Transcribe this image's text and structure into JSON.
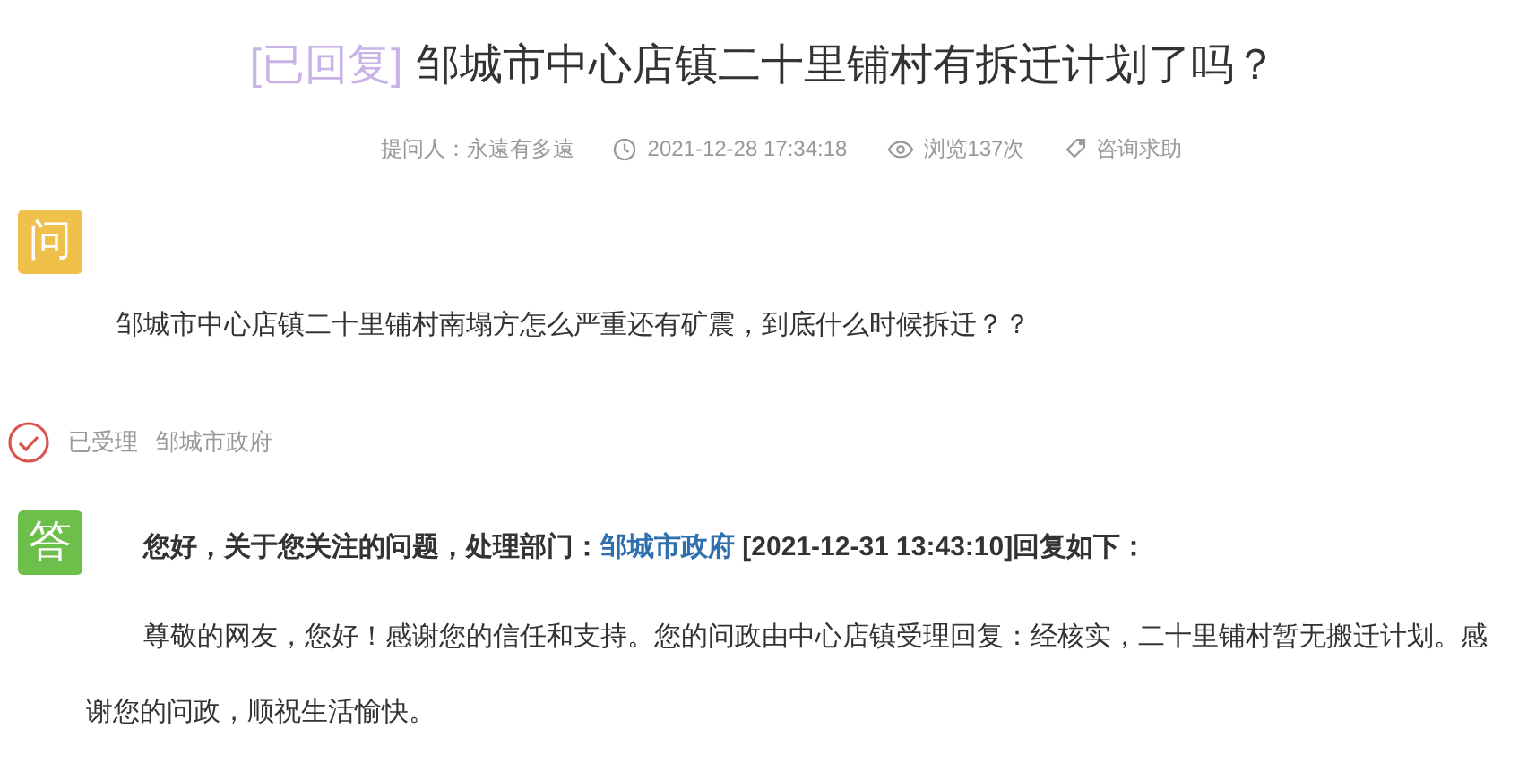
{
  "title": {
    "status": "[已回复]",
    "text": "邹城市中心店镇二十里铺村有拆迁计划了吗？"
  },
  "meta": {
    "asker": "提问人：永遠有多遠",
    "time": "2021-12-28 17:34:18",
    "views": "浏览137次",
    "category": "咨询求助"
  },
  "question": {
    "badge": "问",
    "text": "邹城市中心店镇二十里铺村南塌方怎么严重还有矿震，到底什么时候拆迁？？"
  },
  "handling": {
    "status": "已受理",
    "department": "邹城市政府"
  },
  "answer": {
    "badge": "答",
    "header_before": "您好，关于您关注的问题，处理部门：",
    "department": "邹城市政府",
    "header_after": " [2021-12-31 13:43:10]回复如下：",
    "body": "尊敬的网友，您好！感谢您的信任和支持。您的问政由中心店镇受理回复：经核实，二十里铺村暂无搬迁计划。感谢您的问政，顺祝生活愉快。"
  }
}
